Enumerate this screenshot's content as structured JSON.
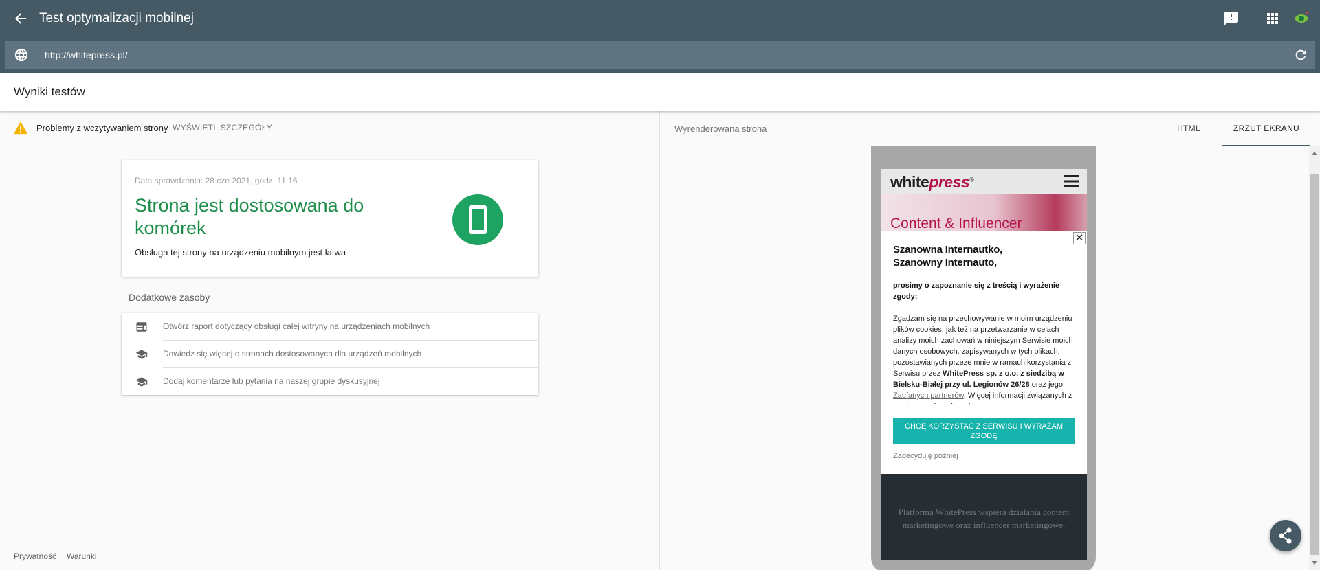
{
  "app": {
    "title": "Test optymalizacji mobilnej",
    "url": "http://whitepress.pl/",
    "brand_color": "#455a64",
    "icons": {
      "back": "arrow-left-icon",
      "feedback": "feedback-icon",
      "apps": "apps-grid-icon",
      "account": "account-logo-icon",
      "globe": "globe-icon",
      "reload": "reload-icon"
    }
  },
  "results": {
    "title": "Wyniki testów"
  },
  "issues": {
    "text": "Problemy z wczytywaniem strony",
    "details_link": "WYŚWIETL SZCZEGÓŁY",
    "icon": "warning-icon"
  },
  "verdict": {
    "date": "Data sprawdzenia: 28 cze 2021, godz. 11:16",
    "title": "Strona jest dostosowana do komórek",
    "subtitle": "Obsługa tej strony na urządzeniu mobilnym jest łatwa",
    "color": "#1e8e4a",
    "icon": "smartphone-icon"
  },
  "resources": {
    "title": "Dodatkowe zasoby",
    "items": [
      {
        "label": "Otwórz raport dotyczący obsługi całej witryny na urządzeniach mobilnych",
        "icon": "report-icon"
      },
      {
        "label": "Dowiedz się więcej o stronach dostosowanych dla urządzeń mobilnych",
        "icon": "school-icon"
      },
      {
        "label": "Dodaj komentarze lub pytania na naszej grupie dyskusyjnej",
        "icon": "school-icon"
      }
    ]
  },
  "footer": {
    "privacy": "Prywatność",
    "terms": "Warunki"
  },
  "rendered": {
    "title": "Wyrenderowana strona",
    "tabs": [
      {
        "label": "HTML",
        "active": false
      },
      {
        "label": "ZRZUT EKRANU",
        "active": true
      }
    ]
  },
  "preview": {
    "logo_main": "white",
    "logo_accent": "press",
    "logo_mark": "®",
    "hero_text": "Content & Influencer",
    "modal": {
      "greeting_line1": "Szanowna Internautko,",
      "greeting_line2": "Szanowny Internauto,",
      "ask": "prosimy o zapoznanie się z treścią i wyrażenie zgody:",
      "body_start": "Zgadzam się na przechowywanie w moim urządzeniu plików cookies, jak też na przetwarzanie w celach analizy moich zachowań w niniejszym Serwisie moich danych osobowych, zapisywanych w tych plikach, pozostawianych przeze mnie w ramach korzystania z Serwisu przez ",
      "body_bold": "WhitePress sp. z o.o. z siedzibą w Bielsku-Białej przy ul. Legionów 26/28",
      "body_mid": " oraz jego ",
      "body_link": "Zaufanych partnerów",
      "body_end": ". Więcej informacji związanych z przetwarzaniem danych",
      "accept": "CHCĘ KORZYSTAĆ Z SERWISU I WYRAŻAM ZGODĘ",
      "later": "Zadecyduję później",
      "close": "✕",
      "accent": "#17b3ad"
    },
    "footer_text": "Platforma WhitePress wspiera działania content marketingowe oraz influencer marketingowe."
  },
  "share": {
    "icon": "share-icon"
  }
}
